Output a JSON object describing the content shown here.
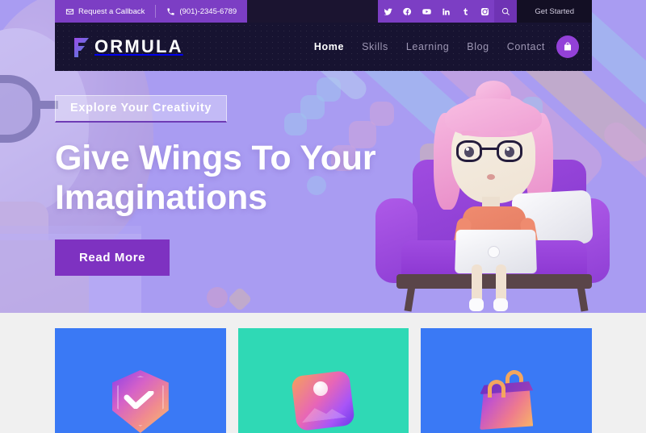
{
  "topbar": {
    "callback_label": "Request a Callback",
    "callback_icon": "envelope-icon",
    "phone_label": "(901)-2345-6789",
    "phone_icon": "phone-icon",
    "social": [
      {
        "name": "twitter-icon",
        "label": "Twitter"
      },
      {
        "name": "facebook-icon",
        "label": "Facebook"
      },
      {
        "name": "youtube-icon",
        "label": "YouTube"
      },
      {
        "name": "linkedin-icon",
        "label": "LinkedIn"
      },
      {
        "name": "tumblr-icon",
        "label": "Tumblr"
      },
      {
        "name": "instagram-icon",
        "label": "Instagram"
      }
    ],
    "search_icon": "search-icon",
    "cta_label": "Get Started"
  },
  "header": {
    "logo_text": "ORMULA",
    "logo_mark": "letter-f-mark",
    "nav": [
      {
        "label": "Home",
        "active": true
      },
      {
        "label": "Skills",
        "active": false
      },
      {
        "label": "Learning",
        "active": false
      },
      {
        "label": "Blog",
        "active": false
      },
      {
        "label": "Contact",
        "active": false
      }
    ],
    "cart_icon": "shopping-bag-icon"
  },
  "hero": {
    "badge": "Explore Your Creativity",
    "headline_line1": "Give Wings To Your",
    "headline_line2": "Imaginations",
    "cta_label": "Read More",
    "illustration": "girl-on-sofa-with-laptop-3d"
  },
  "cards": [
    {
      "name": "card-shield",
      "icon": "shield-check-icon",
      "bg": "#3a79f5"
    },
    {
      "name": "card-image",
      "icon": "image-photo-icon",
      "bg": "#2fd9b5"
    },
    {
      "name": "card-bag",
      "icon": "shopping-bag-icon",
      "bg": "#3a79f5"
    }
  ],
  "colors": {
    "topbar_purple": "#7c3ec4",
    "header_dark": "#171331",
    "hero_purple": "#a99cf2",
    "cta_purple": "#7e32c1",
    "card_blue": "#3a79f5",
    "card_teal": "#2fd9b5",
    "page_gray": "#f0f0f0"
  }
}
